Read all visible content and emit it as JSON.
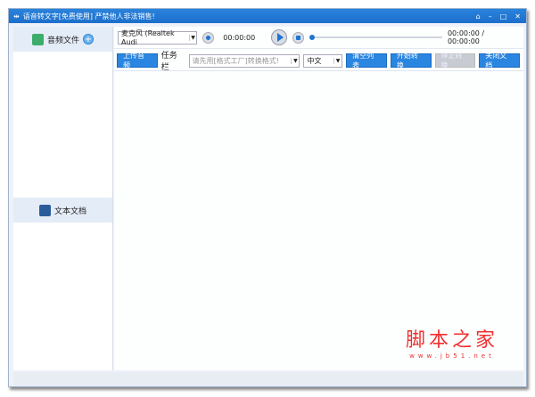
{
  "window": {
    "title": "语音转文字[免费使用]  严禁他人非法销售!",
    "controls": [
      "⌂",
      "–",
      "□",
      "✕"
    ]
  },
  "sidebar": {
    "items": [
      {
        "label": "音频文件",
        "add": "+"
      },
      {
        "label": "文本文档"
      }
    ]
  },
  "player": {
    "device": "麦克风 (Realtek Audi",
    "record_time": "00:00:00",
    "play_time": "00:00:00 / 00:00:00",
    "progress": 0
  },
  "toolbar": {
    "upload": "上传音频",
    "task_label": "任务栏",
    "task_placeholder": "请先用[格式工厂]转换格式!",
    "language": "中文",
    "clear": "清空列表",
    "start": "开始转换",
    "stop": "停止转换",
    "close": "关闭文档"
  },
  "watermark": {
    "text": "脚本之家",
    "url": "www.jb51.net"
  }
}
